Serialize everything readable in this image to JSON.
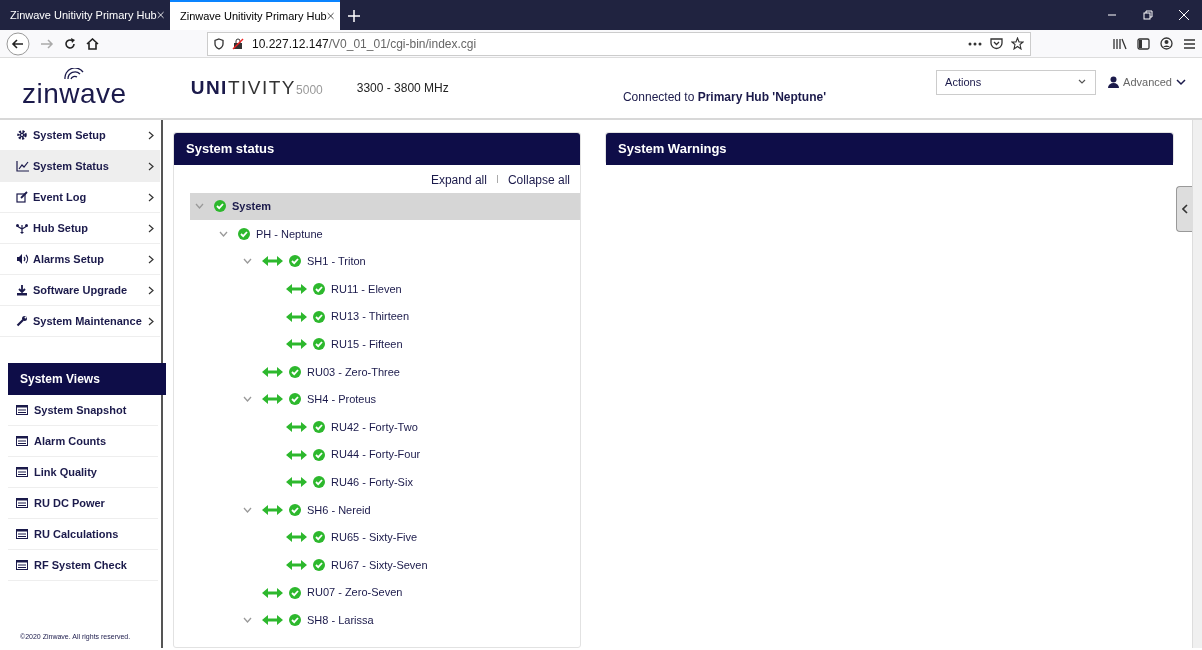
{
  "browser": {
    "tabs": [
      {
        "title": "Zinwave Unitivity Primary Hub",
        "selected": false
      },
      {
        "title": "Zinwave Unitivity Primary Hub",
        "selected": true
      }
    ],
    "url": {
      "host": "10.227.12.147",
      "path": "/V0_01_01/cgi-bin/index.cgi"
    }
  },
  "header": {
    "logo": "zinwave",
    "product": {
      "bold": "UNI",
      "light": "TIVITY",
      "model": "5000"
    },
    "band": "3300 - 3800 MHz",
    "connection": "Connected to **Primary Hub 'Neptune'**",
    "actions": {
      "value": "Actions"
    },
    "user": "Advanced"
  },
  "sidebar": {
    "menu": [
      {
        "label": "System Setup",
        "selected": false
      },
      {
        "label": "System Status",
        "selected": true
      },
      {
        "label": "Event Log",
        "selected": false
      },
      {
        "label": "Hub Setup",
        "selected": false
      },
      {
        "label": "Alarms Setup",
        "selected": false
      },
      {
        "label": "Software Upgrade",
        "selected": false
      },
      {
        "label": "System Maintenance",
        "selected": false
      }
    ],
    "views": {
      "title": "System Views",
      "items": [
        "System Snapshot",
        "Alarm Counts",
        "Link Quality",
        "RU DC Power",
        "RU Calculations",
        "RF System Check"
      ]
    },
    "footer": "©2020 Zinwave. All rights reserved."
  },
  "status": {
    "title": "System status",
    "links": [
      "Expand all",
      "Collapse all"
    ],
    "tree": [
      {
        "label": "System",
        "linked": false,
        "selected": true,
        "expanded": true,
        "children": [
          {
            "label": "PH - Neptune",
            "linked": false,
            "selected": false,
            "expanded": true,
            "children": [
              {
                "label": "SH1 - Triton",
                "linked": true,
                "selected": false,
                "expanded": true,
                "children": [
                  {
                    "label": "RU11 - Eleven",
                    "linked": true,
                    "selected": false
                  },
                  {
                    "label": "RU13 - Thirteen",
                    "linked": true,
                    "selected": false
                  },
                  {
                    "label": "RU15 - Fifteen",
                    "linked": true,
                    "selected": false
                  }
                ]
              },
              {
                "label": "RU03 - Zero-Three",
                "linked": true,
                "selected": false
              },
              {
                "label": "SH4 - Proteus",
                "linked": true,
                "selected": false,
                "expanded": true,
                "children": [
                  {
                    "label": "RU42 - Forty-Two",
                    "linked": true,
                    "selected": false
                  },
                  {
                    "label": "RU44 - Forty-Four",
                    "linked": true,
                    "selected": false
                  },
                  {
                    "label": "RU46 - Forty-Six",
                    "linked": true,
                    "selected": false
                  }
                ]
              },
              {
                "label": "SH6 - Nereid",
                "linked": true,
                "selected": false,
                "expanded": true,
                "children": [
                  {
                    "label": "RU65 - Sixty-Five",
                    "linked": true,
                    "selected": false
                  },
                  {
                    "label": "RU67 - Sixty-Seven",
                    "linked": true,
                    "selected": false
                  }
                ]
              },
              {
                "label": "RU07 - Zero-Seven",
                "linked": true,
                "selected": false
              },
              {
                "label": "SH8 - Larissa",
                "linked": true,
                "selected": false,
                "expanded": true
              }
            ]
          }
        ]
      }
    ]
  },
  "warnings": {
    "title": "System Warnings"
  }
}
